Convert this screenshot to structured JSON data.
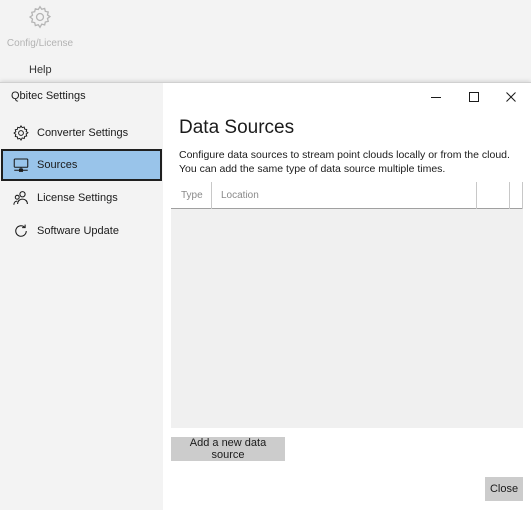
{
  "background_app": {
    "config_label": "Config/License",
    "help_label": "Help"
  },
  "dialog": {
    "title": "Qbitec Settings",
    "window_controls": [
      "minimize",
      "maximize",
      "close"
    ]
  },
  "sidebar": {
    "items": [
      {
        "label": "Converter Settings",
        "icon": "gear-icon",
        "active": false
      },
      {
        "label": "Sources",
        "icon": "monitor-network-icon",
        "active": true
      },
      {
        "label": "License Settings",
        "icon": "users-icon",
        "active": false
      },
      {
        "label": "Software Update",
        "icon": "refresh-icon",
        "active": false
      }
    ]
  },
  "main": {
    "title": "Data Sources",
    "description": "Configure data sources to stream point clouds locally or from the cloud. You can add the same type of data source multiple times.",
    "table": {
      "columns": [
        "Type",
        "Location",
        "",
        ""
      ],
      "rows": []
    },
    "add_button": "Add a new data source",
    "close_button": "Close"
  },
  "colors": {
    "sidebar_bg": "#f3f3f3",
    "active_item_bg": "#99c4ea",
    "button_bg": "#cccccc",
    "table_bg": "#f0f0f0"
  }
}
